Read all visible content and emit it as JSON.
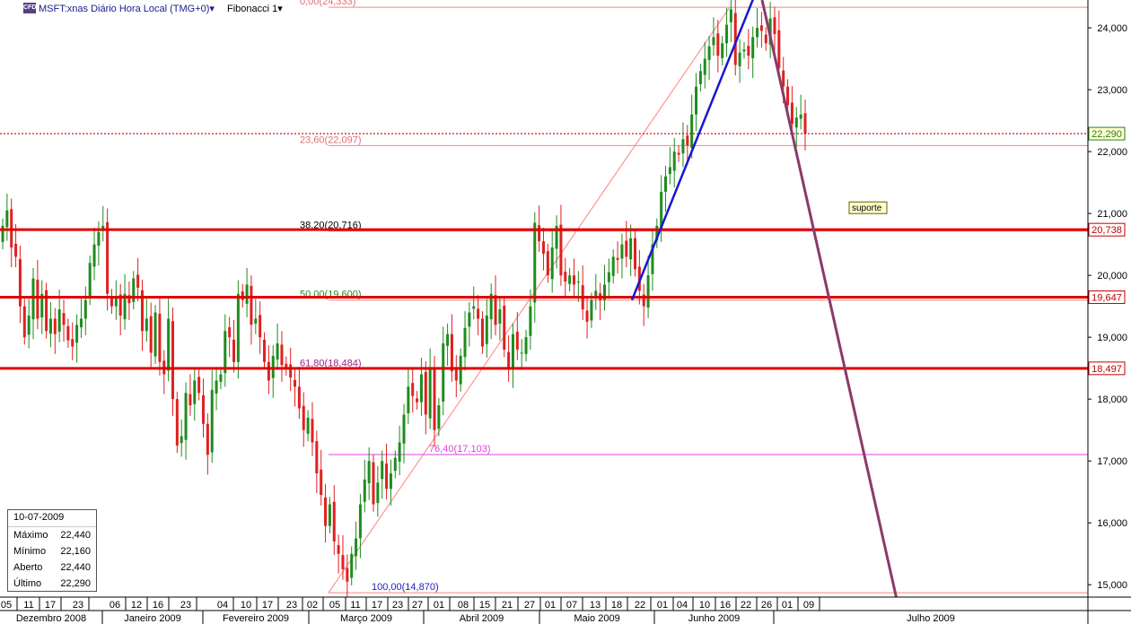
{
  "header": {
    "logo_text": "CFD",
    "symbol_label": "MSFT:xnas Diário Hora Local (TMG+0)▾",
    "study_label": "Fibonacci 1▾"
  },
  "info_box": {
    "date": "10-07-2009",
    "rows": [
      {
        "label": "Máximo",
        "value": "22,440"
      },
      {
        "label": "Mínimo",
        "value": "22,160"
      },
      {
        "label": "Aberto",
        "value": "22,440"
      },
      {
        "label": "Último",
        "value": "22,290"
      }
    ]
  },
  "colors": {
    "up": "#1e8c1e",
    "down": "#e02020",
    "support": "#e00000",
    "fib_line": "#ff8080",
    "trend_blue": "#1818d0",
    "trend_purple": "#8a3a6a",
    "fib_764": "#e040e0",
    "last_price": "#c00000"
  },
  "chart_data": {
    "type": "candlestick",
    "title": "MSFT:xnas Diário Hora Local (TMG+0)",
    "ylim": [
      14.8,
      24.45
    ],
    "y_ticks": [
      "15,000",
      "16,000",
      "17,000",
      "18,000",
      "19,000",
      "20,000",
      "21,000",
      "22,000",
      "23,000",
      "24,000"
    ],
    "y_tick_values": [
      15,
      16,
      17,
      18,
      19,
      20,
      21,
      22,
      23,
      24
    ],
    "x_day_labels": [
      "05",
      "11",
      "17",
      "23",
      "06",
      "12",
      "16",
      "23",
      "04",
      "10",
      "17",
      "23",
      "02",
      "05",
      "11",
      "17",
      "23",
      "27",
      "01",
      "08",
      "15",
      "21",
      "27",
      "01",
      "07",
      "13",
      "18",
      "22",
      "01",
      "04",
      "10",
      "16",
      "22",
      "26",
      "01",
      "09"
    ],
    "x_month_labels": [
      "Dezembro 2008",
      "Janeiro 2009",
      "Fevereiro 2009",
      "Março 2009",
      "Abril 2009",
      "Maio 2009",
      "Junho 2009",
      "Julho 2009"
    ],
    "fibonacci": [
      {
        "label": "0,00(24,333)",
        "price": 24.333
      },
      {
        "label": "23,60(22,097)",
        "price": 22.097
      },
      {
        "label": "38,20(20,716)",
        "price": 20.716
      },
      {
        "label": "50,00(19,600)",
        "price": 19.6
      },
      {
        "label": "61,80(18,484)",
        "price": 18.484
      },
      {
        "label": "76,40(17,103)",
        "price": 17.103
      },
      {
        "label": "100,00(14,870)",
        "price": 14.87
      }
    ],
    "support_lines": [
      {
        "label": "20,738",
        "price": 20.738
      },
      {
        "label": "19,647",
        "price": 19.647
      },
      {
        "label": "18,497",
        "price": 18.497
      }
    ],
    "last_price": {
      "label": "22,290",
      "price": 22.29
    },
    "annotation": "suporte",
    "closes": [
      20.8,
      21.05,
      20.45,
      20.3,
      19.5,
      19.0,
      19.35,
      19.95,
      19.3,
      19.7,
      19.1,
      19.3,
      19.05,
      19.45,
      19.2,
      18.95,
      18.85,
      19.2,
      19.3,
      19.6,
      20.2,
      20.5,
      20.7,
      20.8,
      19.7,
      19.5,
      19.65,
      19.35,
      19.7,
      19.55,
      19.95,
      19.8,
      19.1,
      19.3,
      18.75,
      19.4,
      18.6,
      18.4,
      19.3,
      18.0,
      17.25,
      17.4,
      18.1,
      17.9,
      18.3,
      18.1,
      17.6,
      17.1,
      18.15,
      18.3,
      18.4,
      19.1,
      19.0,
      18.6,
      19.7,
      19.6,
      19.85,
      19.2,
      19.3,
      19.0,
      18.6,
      18.3,
      18.7,
      18.9,
      18.55,
      18.5,
      18.35,
      18.2,
      17.85,
      17.5,
      17.7,
      17.3,
      16.8,
      16.45,
      15.95,
      16.3,
      15.7,
      15.5,
      15.25,
      15.05,
      15.5,
      15.75,
      16.3,
      16.7,
      17.0,
      16.3,
      16.65,
      17.0,
      16.55,
      16.8,
      17.05,
      17.3,
      17.75,
      18.2,
      18.05,
      17.95,
      18.4,
      17.75,
      18.5,
      17.5,
      17.9,
      18.9,
      19.05,
      18.45,
      18.3,
      18.7,
      19.15,
      19.4,
      19.5,
      19.3,
      18.85,
      19.35,
      19.7,
      19.2,
      19.45,
      18.8,
      18.5,
      19.05,
      18.8,
      18.75,
      19.0,
      19.5,
      20.85,
      20.55,
      20.35,
      20.0,
      20.45,
      20.8,
      20.0,
      19.9,
      20.0,
      19.85,
      19.9,
      19.45,
      19.25,
      19.6,
      19.75,
      19.6,
      19.85,
      20.05,
      20.3,
      20.25,
      20.5,
      20.3,
      20.6,
      20.1,
      19.75,
      19.5,
      20.0,
      20.5,
      20.8,
      21.35,
      21.6,
      21.75,
      22.0,
      21.95,
      22.2,
      22.1,
      22.6,
      23.05,
      23.3,
      23.5,
      23.7,
      23.85,
      23.55,
      23.75,
      24.05,
      24.3,
      23.4,
      23.6,
      23.65,
      23.55,
      23.85,
      24.0,
      23.95,
      23.75,
      24.15,
      23.9,
      23.35,
      23.05,
      22.75,
      22.45,
      22.55,
      22.6,
      22.29
    ]
  }
}
